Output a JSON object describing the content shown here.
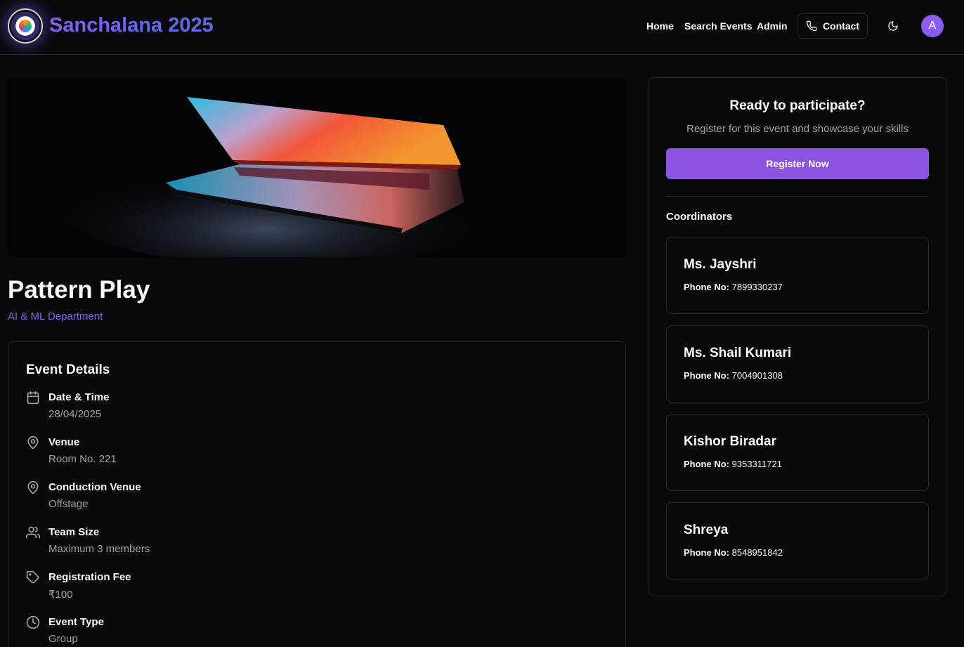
{
  "header": {
    "brand": "Sanchalana 2025",
    "nav": [
      "Home",
      "Search Events",
      "Admin"
    ],
    "contact_label": "Contact",
    "avatar_initial": "A"
  },
  "event": {
    "title": "Pattern Play",
    "department": "AI & ML Department",
    "details_title": "Event Details",
    "details": [
      {
        "icon": "calendar-icon",
        "label": "Date & Time",
        "value": "28/04/2025"
      },
      {
        "icon": "map-pin-icon",
        "label": "Venue",
        "value": "Room No. 221"
      },
      {
        "icon": "map-pin-icon",
        "label": "Conduction Venue",
        "value": "Offstage"
      },
      {
        "icon": "users-icon",
        "label": "Team Size",
        "value": "Maximum 3 members"
      },
      {
        "icon": "tag-icon",
        "label": "Registration Fee",
        "value": "₹100"
      },
      {
        "icon": "clock-icon",
        "label": "Event Type",
        "value": "Group"
      }
    ]
  },
  "panel": {
    "title": "Ready to participate?",
    "subtitle": "Register for this event and showcase your skills",
    "register_label": "Register Now",
    "coordinators_title": "Coordinators",
    "phone_label": "Phone No:",
    "coordinators": [
      {
        "name": "Ms. Jayshri",
        "phone": "7899330237"
      },
      {
        "name": "Ms. Shail Kumari",
        "phone": "7004901308"
      },
      {
        "name": "Kishor Biradar",
        "phone": "9353311721"
      },
      {
        "name": "Shreya",
        "phone": "8548951842"
      }
    ]
  },
  "colors": {
    "accent": "#8b5cf6",
    "background": "#09090b",
    "border": "#27272a",
    "muted": "#a1a1aa"
  }
}
